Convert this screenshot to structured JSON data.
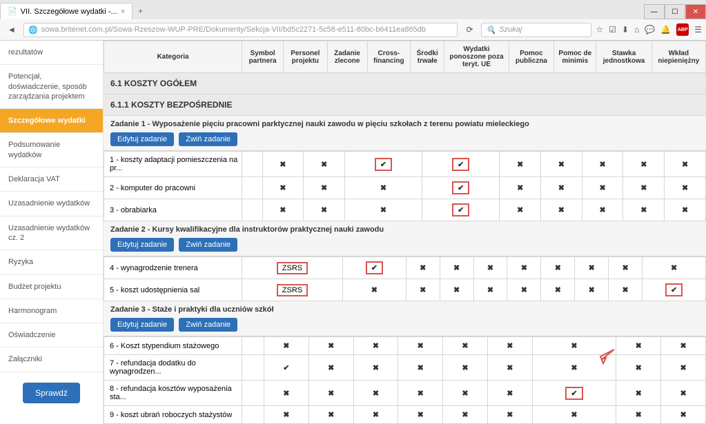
{
  "browser": {
    "tab_title": "VII. Szczegółowe wydatki -...",
    "url": "sowa.britenet.com.pl/Sowa-Rzeszow-WUP-PRE/Dokumenty/Sekcja-VII/bd5c2271-5c58-e511-80bc-b6411ea865db",
    "search_placeholder": "Szukaj"
  },
  "sidebar": {
    "items": [
      "rezultatów",
      "Potencjał, doświadczenie, sposób zarządzania projektem",
      "Szczegółowe wydatki",
      "Podsumowanie wydatków",
      "Deklaracja VAT",
      "Uzasadnienie wydatków",
      "Uzasadnienie wydatków cz. 2",
      "Ryzyka",
      "Budżet projektu",
      "Harmonogram",
      "Oświadczenie",
      "Załączniki"
    ],
    "active_index": 2,
    "check_button": "Sprawdź"
  },
  "headers": {
    "kategoria": "Kategoria",
    "symbol": "Symbol partnera",
    "personel": "Personel projektu",
    "zlecone": "Zadanie zlecone",
    "cross": "Cross-financing",
    "trwale": "Środki trwałe",
    "poza_ue": "Wydatki ponoszone poza teryt. UE",
    "publiczna": "Pomoc publiczna",
    "minimis": "Pomoc de minimis",
    "stawka": "Stawka jednostkowa",
    "wklad": "Wkład niepieniężny"
  },
  "sections": {
    "s61": "6.1 KOSZTY OGÓŁEM",
    "s611": "6.1.1 KOSZTY BEZPOŚREDNIE"
  },
  "tasks": {
    "t1": "Zadanie 1 - Wyposażenie pięciu pracowni parktycznej nauki zawodu w pięciu szkołach z terenu powiatu mieleckiego",
    "t2": "Zadanie 2 - Kursy kwalifikacyjne dla instruktorów praktycznej nauki zawodu",
    "t3": "Zadanie 3 - Staże i praktyki dla uczniów szkół",
    "edit": "Edytuj zadanie",
    "collapse": "Zwiń zadanie"
  },
  "rows": {
    "r1": {
      "cat": "1 - koszty adaptacji pomieszczenia na pr...",
      "sym": "",
      "vals": [
        "x",
        "x",
        "v",
        "v",
        "x",
        "x",
        "x",
        "x",
        "x"
      ],
      "hl": [
        2,
        3
      ]
    },
    "r2": {
      "cat": "2 - komputer do pracowni",
      "sym": "",
      "vals": [
        "x",
        "x",
        "x",
        "v",
        "x",
        "x",
        "x",
        "x",
        "x"
      ],
      "hl": [
        3
      ]
    },
    "r3": {
      "cat": "3 - obrabiarka",
      "sym": "",
      "vals": [
        "x",
        "x",
        "x",
        "v",
        "x",
        "x",
        "x",
        "x",
        "x"
      ],
      "hl": [
        3
      ]
    },
    "r4": {
      "cat": "4 - wynagrodzenie trenera",
      "sym": "ZSRS",
      "vals": [
        "v",
        "x",
        "x",
        "x",
        "x",
        "x",
        "x",
        "x",
        "x"
      ],
      "hl": [
        0
      ],
      "hl_sym": true
    },
    "r5": {
      "cat": "5 - koszt udostępnienia sal",
      "sym": "ZSRS",
      "vals": [
        "x",
        "x",
        "x",
        "x",
        "x",
        "x",
        "x",
        "x",
        "v"
      ],
      "hl": [
        8
      ],
      "hl_sym": true
    },
    "r6": {
      "cat": "6 - Koszt stypendium stażowego",
      "sym": "",
      "vals": [
        "x",
        "x",
        "x",
        "x",
        "x",
        "x",
        "x",
        "x",
        "x"
      ],
      "hl": []
    },
    "r7": {
      "cat": "7 - refundacja dodatku do wynagrodzen...",
      "sym": "",
      "vals": [
        "v",
        "x",
        "x",
        "x",
        "x",
        "x",
        "x",
        "x",
        "x"
      ],
      "hl": [],
      "arrow": true
    },
    "r8": {
      "cat": "8 - refundacja kosztów wyposażenia sta...",
      "sym": "",
      "vals": [
        "x",
        "x",
        "x",
        "x",
        "x",
        "x",
        "v",
        "x",
        "x"
      ],
      "hl": [
        6
      ]
    },
    "r9": {
      "cat": "9 - koszt ubrań roboczych stażystów",
      "sym": "",
      "vals": [
        "x",
        "x",
        "x",
        "x",
        "x",
        "x",
        "x",
        "x",
        "x"
      ],
      "hl": []
    }
  }
}
